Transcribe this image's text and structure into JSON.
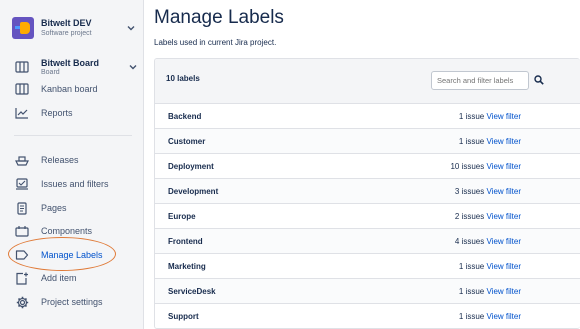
{
  "project": {
    "name": "Bitwelt DEV",
    "type": "Software project"
  },
  "nav": {
    "board": {
      "label": "Bitwelt Board",
      "sub": "Board"
    },
    "items": [
      {
        "label": "Kanban board",
        "icon": "columns-icon"
      },
      {
        "label": "Reports",
        "icon": "chart-line-icon"
      },
      {
        "label": "Releases",
        "icon": "ship-icon"
      },
      {
        "label": "Issues and filters",
        "icon": "issues-icon"
      },
      {
        "label": "Pages",
        "icon": "page-icon"
      },
      {
        "label": "Components",
        "icon": "component-icon"
      },
      {
        "label": "Manage Labels",
        "icon": "label-icon",
        "active": true
      },
      {
        "label": "Add item",
        "icon": "add-item-icon"
      },
      {
        "label": "Project settings",
        "icon": "gear-icon"
      }
    ]
  },
  "main": {
    "title": "Manage Labels",
    "description": "Labels used in current Jira project.",
    "count_label": "10 labels",
    "search_placeholder": "Search and filter labels",
    "view_filter_label": "View filter",
    "labels": [
      {
        "name": "Backend",
        "count": "1 issue"
      },
      {
        "name": "Customer",
        "count": "1 issue"
      },
      {
        "name": "Deployment",
        "count": "10 issues"
      },
      {
        "name": "Development",
        "count": "3 issues"
      },
      {
        "name": "Europe",
        "count": "2 issues"
      },
      {
        "name": "Frontend",
        "count": "4 issues"
      },
      {
        "name": "Marketing",
        "count": "1 issue"
      },
      {
        "name": "ServiceDesk",
        "count": "1 issue"
      },
      {
        "name": "Support",
        "count": "1 issue"
      }
    ]
  },
  "colors": {
    "accent": "#0052cc",
    "highlight_ring": "#e07b39",
    "project_avatar": "#6554c0"
  }
}
